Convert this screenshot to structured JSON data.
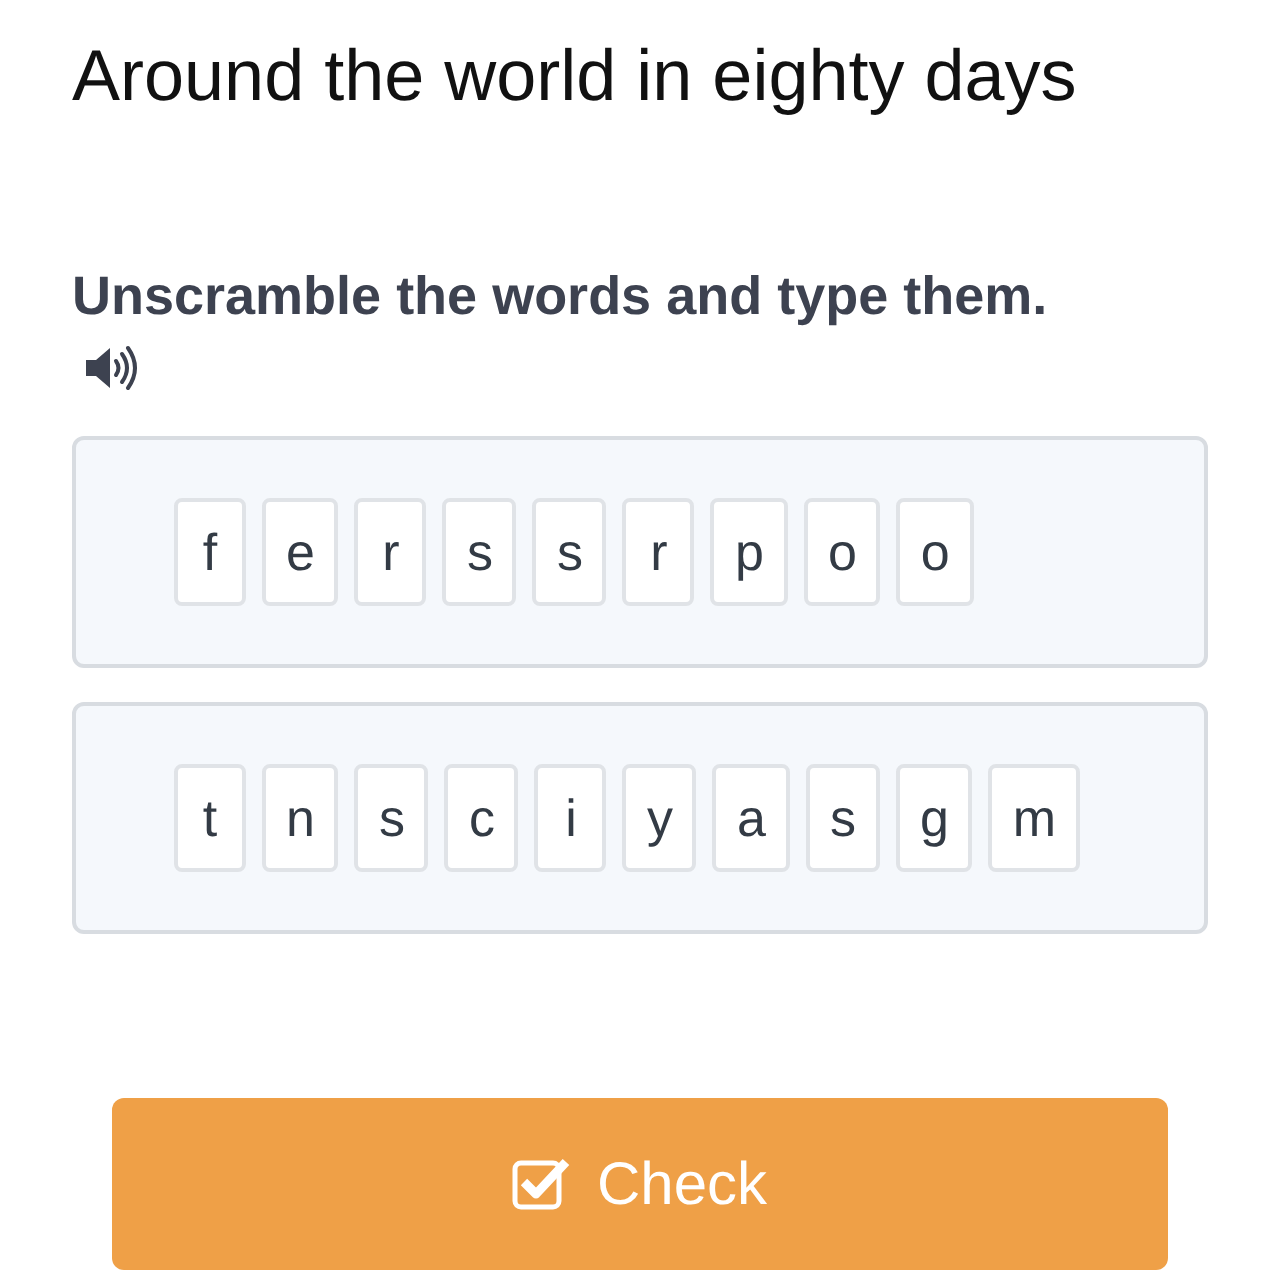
{
  "title": "Around the world in eighty days",
  "instruction": "Unscramble the words and type them.",
  "puzzles": [
    {
      "letters": [
        "f",
        "e",
        "r",
        "s",
        "s",
        "r",
        "p",
        "o",
        "o"
      ]
    },
    {
      "letters": [
        "t",
        "n",
        "s",
        "c",
        "i",
        "y",
        "a",
        "s",
        "g",
        "m"
      ]
    }
  ],
  "button": {
    "label": "Check"
  }
}
